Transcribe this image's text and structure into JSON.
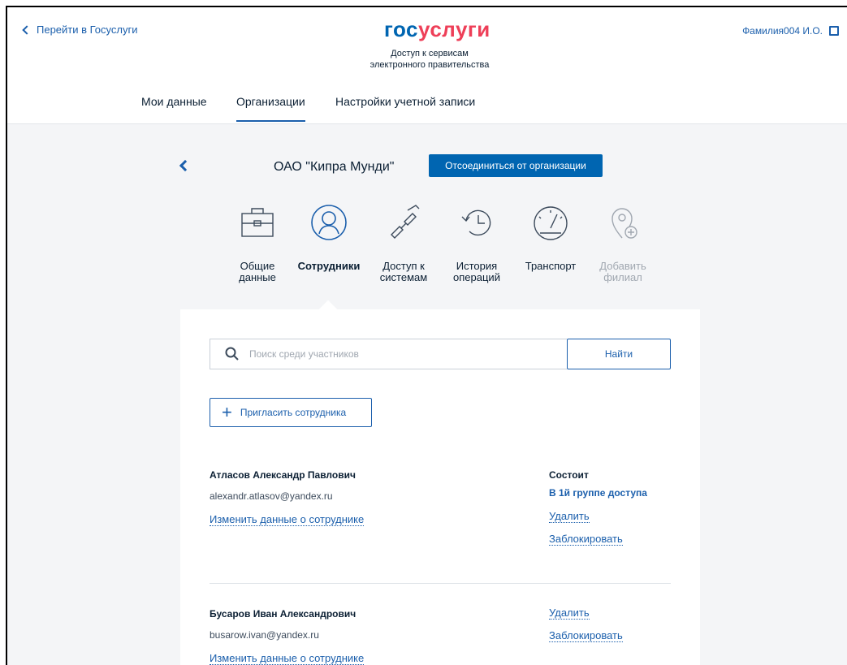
{
  "header": {
    "back_link": "Перейти в Госуслуги",
    "logo_gos": "гос",
    "logo_uslugi": "услуги",
    "tagline_line1": "Доступ к сервисам",
    "tagline_line2": "электронного правительства",
    "user_name": "Фамилия004 И.О."
  },
  "nav": {
    "items": [
      {
        "label": "Мои данные"
      },
      {
        "label": "Организации"
      },
      {
        "label": "Настройки учетной записи"
      }
    ],
    "active": "Организации"
  },
  "org": {
    "name": "ОАО \"Кипра Мунди\"",
    "detach_label": "Отсоединиться от организации"
  },
  "tabs": [
    {
      "label": "Общие\nданные",
      "icon": "briefcase-icon"
    },
    {
      "label": "Сотрудники",
      "icon": "user-circle-icon"
    },
    {
      "label": "Доступ к\nсистемам",
      "icon": "link-icon"
    },
    {
      "label": "История\nопераций",
      "icon": "history-icon"
    },
    {
      "label": "Транспорт",
      "icon": "speedometer-icon"
    },
    {
      "label": "Добавить\nфилиал",
      "icon": "location-add-icon"
    }
  ],
  "search": {
    "placeholder": "Поиск среди участников",
    "button_label": "Найти"
  },
  "invite_label": "Пригласить сотрудника",
  "employees": [
    {
      "name": "Атласов Александр Павлович",
      "email": "alexandr.atlasov@yandex.ru",
      "edit_label": "Изменить данные о сотруднике",
      "status_label": "Состоит",
      "group_label": "В 1й группе доступа",
      "delete_label": "Удалить",
      "block_label": "Заблокировать"
    },
    {
      "name": "Бусаров Иван Александрович",
      "email": "busarow.ivan@yandex.ru",
      "edit_label": "Изменить данные о сотруднике",
      "delete_label": "Удалить",
      "block_label": "Заблокировать"
    }
  ],
  "colors": {
    "accent": "#1b5fac",
    "brand_blue": "#0065b1",
    "brand_red": "#ee3f58",
    "background": "#f4f5f7"
  }
}
